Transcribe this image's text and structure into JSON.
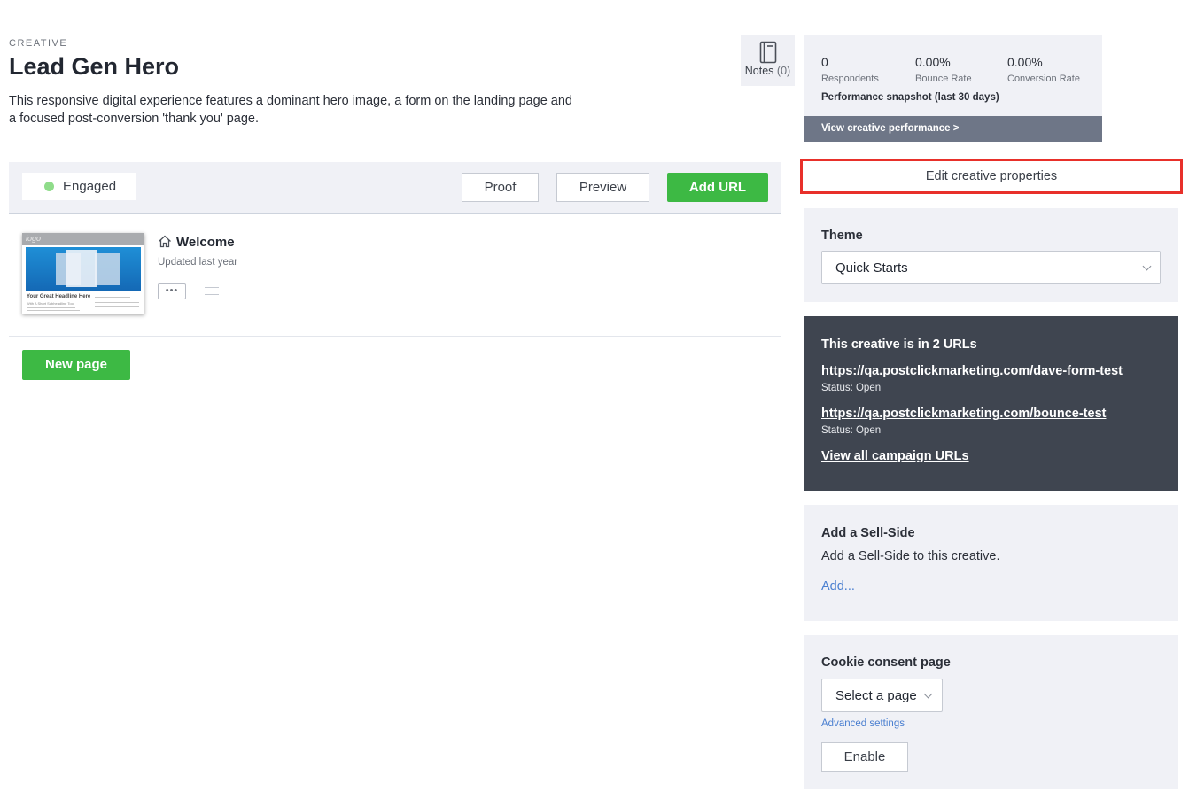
{
  "header": {
    "eyebrow": "CREATIVE",
    "title": "Lead Gen Hero",
    "description": "This responsive digital experience features a dominant hero image, a form on the landing page and a focused post-conversion 'thank you' page.",
    "notes_label": "Notes",
    "notes_count": "(0)"
  },
  "toolbar": {
    "status": "Engaged",
    "status_color": "#8fdc8a",
    "proof_label": "Proof",
    "preview_label": "Preview",
    "add_url_label": "Add URL"
  },
  "pages": [
    {
      "title": "Welcome",
      "updated": "Updated last year",
      "more_label": "•••",
      "thumbnail": {
        "logo": "logo",
        "headline": "Your Great Headline Here",
        "subheadline": "With A Short Subheadline Too"
      }
    }
  ],
  "new_page_label": "New page",
  "performance": {
    "respondents_value": "0",
    "respondents_label": "Respondents",
    "bounce_value": "0.00%",
    "bounce_label": "Bounce Rate",
    "conversion_value": "0.00%",
    "conversion_label": "Conversion Rate",
    "snapshot": "Performance snapshot (last 30 days)",
    "view_link": "View creative performance >"
  },
  "edit_properties_label": "Edit creative properties",
  "theme": {
    "title": "Theme",
    "selected": "Quick Starts"
  },
  "urls": {
    "title": "This creative is in 2 URLs",
    "items": [
      {
        "url": "https://qa.postclickmarketing.com/dave-form-test",
        "status": "Status: Open"
      },
      {
        "url": "https://qa.postclickmarketing.com/bounce-test",
        "status": "Status: Open"
      }
    ],
    "view_all": "View all campaign URLs"
  },
  "sell_side": {
    "title": "Add a Sell-Side",
    "text": "Add a Sell-Side to this creative.",
    "add_link": "Add..."
  },
  "cookie": {
    "title": "Cookie consent page",
    "select": "Select a page",
    "advanced": "Advanced settings",
    "enable": "Enable"
  },
  "colors": {
    "accent_green": "#3db944",
    "dark_panel": "#3f4550",
    "highlight_red": "#e8302a",
    "link_blue": "#4a7fd0"
  }
}
